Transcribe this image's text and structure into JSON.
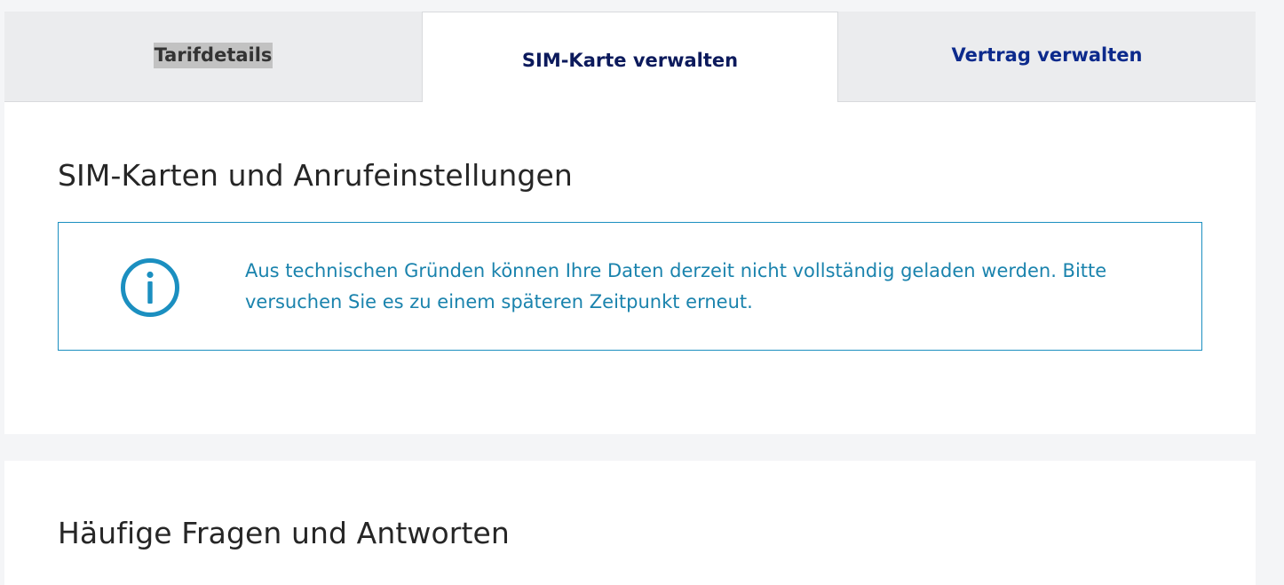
{
  "tabs": [
    {
      "label": "Tarifdetails",
      "active": false
    },
    {
      "label": "SIM-Karte verwalten",
      "active": true
    },
    {
      "label": "Vertrag verwalten",
      "active": false
    }
  ],
  "sim_section": {
    "title": "SIM-Karten und Anrufeinstellungen",
    "notice": {
      "icon": "info-icon",
      "message": "Aus technischen Gründen können Ihre Daten derzeit nicht vollständig geladen werden. Bitte versuchen Sie es zu einem späteren Zeitpunkt erneut."
    }
  },
  "faq_section": {
    "title": "Häufige Fragen und Antworten"
  },
  "colors": {
    "notice_accent": "#1b8fc0",
    "active_tab_text": "#0c1a5c",
    "link_tab_text": "#0c2a8c",
    "tab_background": "#ebecee"
  }
}
